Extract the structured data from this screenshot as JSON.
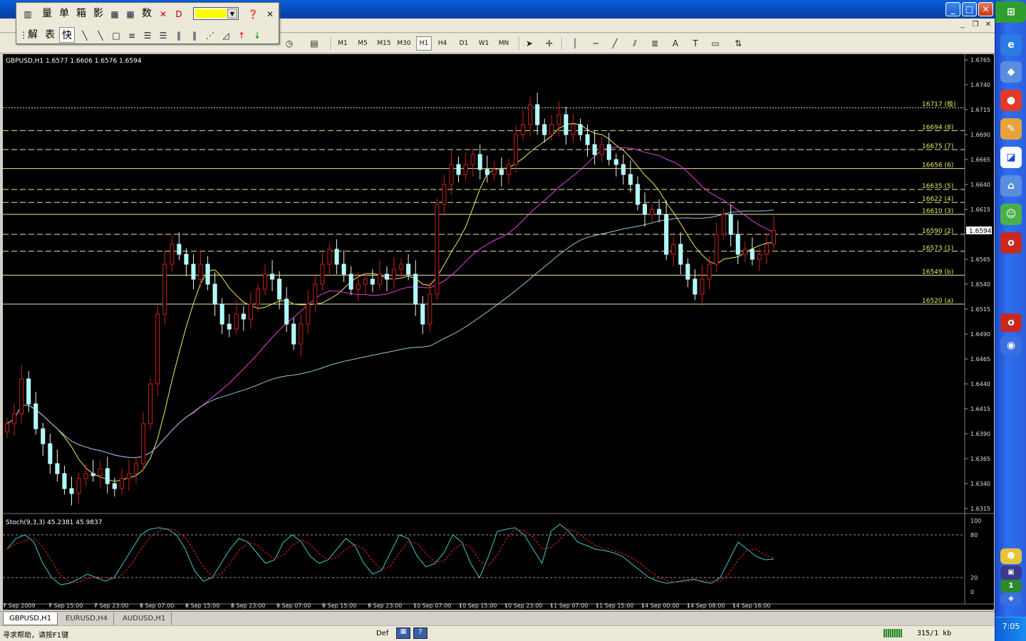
{
  "window": {
    "min_label": "_",
    "max_label": "□",
    "close_label": "✕"
  },
  "mdi": {
    "min": "_",
    "restore": "❐",
    "close": "✕"
  },
  "floating_toolbar": {
    "row1": [
      "量",
      "单",
      "箱",
      "影",
      "数"
    ],
    "row2": [
      "解",
      "表",
      "快"
    ]
  },
  "timeframes": [
    "M1",
    "M5",
    "M15",
    "M30",
    "H1",
    "H4",
    "D1",
    "W1",
    "MN"
  ],
  "active_timeframe": "H1",
  "chart": {
    "header": "GBPUSD,H1  1.6577 1.6606 1.6576 1.6594",
    "current_price": "1.6594",
    "price_axis": [
      "1.6765",
      "1.6740",
      "1.6715",
      "1.6690",
      "1.6665",
      "1.6640",
      "1.6615",
      "1.6565",
      "1.6540",
      "1.6515",
      "1.6490",
      "1.6465",
      "1.6440",
      "1.6415",
      "1.6390",
      "1.6365",
      "1.6340",
      "1.6315"
    ],
    "levels": [
      {
        "label": "16717 (极)",
        "price": 1.6717,
        "style": "dotted"
      },
      {
        "label": "16694 (8)",
        "price": 1.6694,
        "style": "dashed"
      },
      {
        "label": "16675 (7)",
        "price": 1.6675,
        "style": "dashed"
      },
      {
        "label": "16656 (6)",
        "price": 1.6656,
        "style": "solid"
      },
      {
        "label": "16635 (5)",
        "price": 1.6635,
        "style": "dashed"
      },
      {
        "label": "16622 (4)",
        "price": 1.6622,
        "style": "dashed"
      },
      {
        "label": "16610 (3)",
        "price": 1.661,
        "style": "solid"
      },
      {
        "label": "16590 (2)",
        "price": 1.659,
        "style": "dashed"
      },
      {
        "label": "16573 (1)",
        "price": 1.6573,
        "style": "dashed"
      },
      {
        "label": "16549 (b)",
        "price": 1.6549,
        "style": "solid"
      },
      {
        "label": "16520 (a)",
        "price": 1.652,
        "style": "solid"
      }
    ],
    "time_axis": [
      "7 Sep 2009",
      "7 Sep 15:00",
      "7 Sep 23:00",
      "8 Sep 07:00",
      "8 Sep 15:00",
      "8 Sep 23:00",
      "9 Sep 07:00",
      "9 Sep 15:00",
      "9 Sep 23:00",
      "10 Sep 07:00",
      "10 Sep 15:00",
      "10 Sep 23:00",
      "11 Sep 07:00",
      "11 Sep 15:00",
      "14 Sep 00:00",
      "14 Sep 08:00",
      "14 Sep 16:00"
    ],
    "stoch_header": "Stoch(9,3,3) 45.2381 45.9837",
    "stoch_axis": [
      "100",
      "80",
      "20",
      "0"
    ]
  },
  "chart_data": {
    "type": "candlestick",
    "symbol": "GBPUSD",
    "timeframe": "H1",
    "ylim": [
      1.6315,
      1.6765
    ],
    "closes": [
      1.64,
      1.641,
      1.6445,
      1.642,
      1.6395,
      1.638,
      1.636,
      1.635,
      1.6335,
      1.633,
      1.6345,
      1.635,
      1.6348,
      1.6355,
      1.634,
      1.6335,
      1.6345,
      1.635,
      1.636,
      1.64,
      1.644,
      1.651,
      1.656,
      1.658,
      1.657,
      1.656,
      1.6545,
      1.656,
      1.654,
      1.652,
      1.65,
      1.6495,
      1.651,
      1.6505,
      1.652,
      1.6535,
      1.655,
      1.6545,
      1.6525,
      1.65,
      1.648,
      1.65,
      1.652,
      1.654,
      1.656,
      1.6575,
      1.656,
      1.655,
      1.6535,
      1.654,
      1.6545,
      1.654,
      1.655,
      1.6545,
      1.6555,
      1.656,
      1.655,
      1.652,
      1.65,
      1.653,
      1.662,
      1.664,
      1.666,
      1.665,
      1.666,
      1.667,
      1.6655,
      1.665,
      1.6655,
      1.665,
      1.666,
      1.669,
      1.67,
      1.672,
      1.67,
      1.669,
      1.67,
      1.671,
      1.669,
      1.67,
      1.669,
      1.668,
      1.667,
      1.668,
      1.6665,
      1.666,
      1.665,
      1.664,
      1.662,
      1.661,
      1.6615,
      1.661,
      1.657,
      1.658,
      1.656,
      1.6545,
      1.653,
      1.6545,
      1.656,
      1.659,
      1.661,
      1.659,
      1.657,
      1.6575,
      1.6565,
      1.657,
      1.658,
      1.6594
    ],
    "stoch_k": [
      60,
      75,
      80,
      70,
      40,
      20,
      10,
      12,
      18,
      25,
      20,
      15,
      20,
      40,
      60,
      80,
      88,
      90,
      88,
      80,
      60,
      30,
      15,
      20,
      40,
      60,
      75,
      70,
      55,
      40,
      45,
      70,
      80,
      70,
      50,
      40,
      45,
      60,
      75,
      65,
      40,
      25,
      30,
      55,
      80,
      75,
      50,
      35,
      40,
      55,
      80,
      70,
      40,
      20,
      50,
      85,
      88,
      90,
      80,
      60,
      40,
      85,
      95,
      85,
      70,
      65,
      60,
      58,
      55,
      50,
      40,
      30,
      20,
      15,
      12,
      14,
      16,
      18,
      14,
      12,
      20,
      45,
      70,
      60,
      50,
      45,
      46
    ]
  },
  "tabs": [
    "GBPUSD,H1",
    "EURUSD,H4",
    "AUDUSD,H1"
  ],
  "status": {
    "help": "寻求帮助，请按F1键",
    "profile": "Def",
    "traffic": "315/1 kb"
  },
  "clock": "7:05"
}
